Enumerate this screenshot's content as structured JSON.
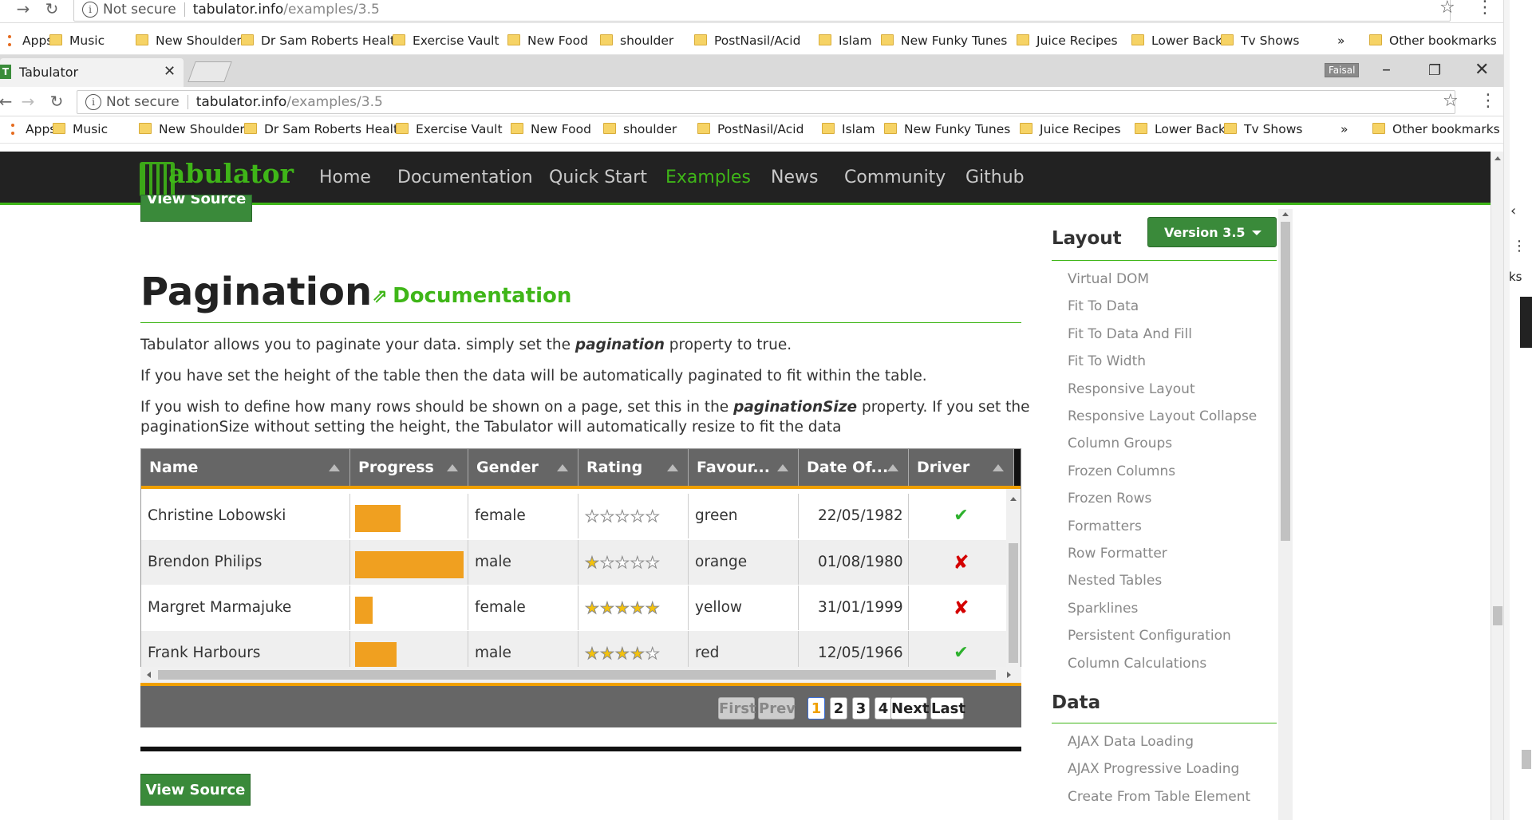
{
  "browser": {
    "outer_url": {
      "not_secure": "Not secure",
      "host": "tabulator.info",
      "path": "/examples/3.5"
    },
    "inner_url": {
      "not_secure": "Not secure",
      "host": "tabulator.info",
      "path": "/examples/3.5"
    },
    "bookmarks": [
      "Apps",
      "Music",
      "New Shoulder",
      "Dr Sam Roberts Healt",
      "Exercise Vault",
      "New Food",
      "shoulder",
      "PostNasil/Acid",
      "Islam",
      "New Funky Tunes",
      "Juice Recipes",
      "Lower Back",
      "Tv Shows"
    ],
    "bookmarks_overflow": "»",
    "other_bookmarks": "Other bookmarks",
    "tab_title": "Tabulator",
    "tab_favicon": "T",
    "profile_name": "Faisal",
    "right_edge_text": "ks"
  },
  "site": {
    "logo_text": "abulator",
    "nav": [
      "Home",
      "Documentation",
      "Quick Start",
      "Examples",
      "News",
      "Community",
      "Github"
    ],
    "active_nav": "Examples",
    "accent_color": "#3fb618"
  },
  "content": {
    "view_source_top": "View Source",
    "title": "Pagination",
    "doc_link": "Documentation",
    "para1_pre": "Tabulator allows you to paginate your data. simply set the ",
    "para1_em": "pagination",
    "para1_post": " property to true.",
    "para2": "If you have set the height of the table then the data will be automatically paginated to fit within the table.",
    "para3_pre": "If you wish to define how many rows should be shown on a page, set this in the ",
    "para3_em": "paginationSize",
    "para3_post": " property. If you set the",
    "para3_line2": "paginationSize without setting the height, the Tabulator will automatically resize to fit the data",
    "view_source_bottom": "View Source"
  },
  "table": {
    "columns": [
      "Name",
      "Progress",
      "Gender",
      "Rating",
      "Favour...",
      "Date Of...",
      "Driver"
    ],
    "rows": [
      {
        "name": "Christine Lobowski",
        "progress": 0.42,
        "gender": "female",
        "rating": 0,
        "color": "green",
        "dob": "22/05/1982",
        "driver": true
      },
      {
        "name": "Brendon Philips",
        "progress": 1.0,
        "gender": "male",
        "rating": 1,
        "color": "orange",
        "dob": "01/08/1980",
        "driver": false
      },
      {
        "name": "Margret Marmajuke",
        "progress": 0.16,
        "gender": "female",
        "rating": 5,
        "color": "yellow",
        "dob": "31/01/1999",
        "driver": false
      },
      {
        "name": "Frank Harbours",
        "progress": 0.38,
        "gender": "male",
        "rating": 4,
        "color": "red",
        "dob": "12/05/1966",
        "driver": true
      }
    ],
    "pagination": {
      "first": "First",
      "prev": "Prev",
      "pages": [
        "1",
        "2",
        "3",
        "4"
      ],
      "current": "1",
      "next": "Next",
      "last": "Last"
    },
    "header_color": "#666666",
    "progress_color": "#f0a020"
  },
  "sidebar": {
    "layout_heading": "Layout",
    "version_button": "Version 3.5",
    "layout_items": [
      "Virtual DOM",
      "Fit To Data",
      "Fit To Data And Fill",
      "Fit To Width",
      "Responsive Layout",
      "Responsive Layout Collapse",
      "Column Groups",
      "Frozen Columns",
      "Frozen Rows",
      "Formatters",
      "Row Formatter",
      "Nested Tables",
      "Sparklines",
      "Persistent Configuration",
      "Column Calculations"
    ],
    "data_heading": "Data",
    "data_items": [
      "AJAX Data Loading",
      "AJAX Progressive Loading",
      "Create From Table Element"
    ]
  }
}
